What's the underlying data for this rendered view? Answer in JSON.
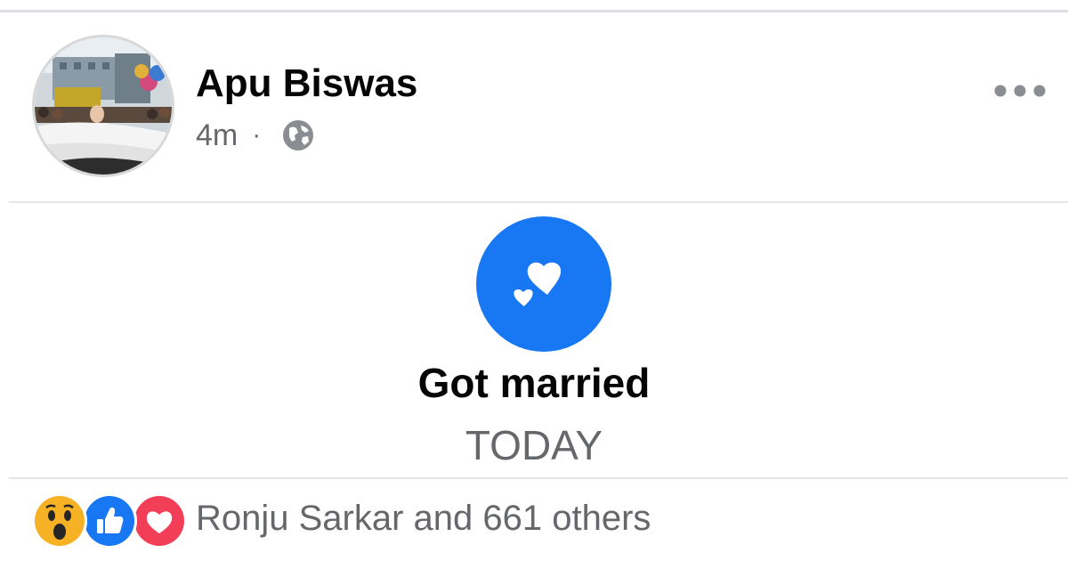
{
  "post": {
    "author": "Apu Biswas",
    "time": "4m",
    "separator": "·",
    "privacy_icon": "globe-icon",
    "menu_icon": "more-horizontal-icon"
  },
  "life_event": {
    "icon": "hearts-icon",
    "title": "Got married",
    "date": "TODAY"
  },
  "reactions": {
    "types": [
      "wow",
      "like",
      "love"
    ],
    "summary": "Ronju Sarkar and 661 others"
  },
  "colors": {
    "accent_blue": "#1877f2",
    "love_red": "#f33e58",
    "wow_yellow": "#f7b125",
    "secondary_text": "#65676b"
  }
}
